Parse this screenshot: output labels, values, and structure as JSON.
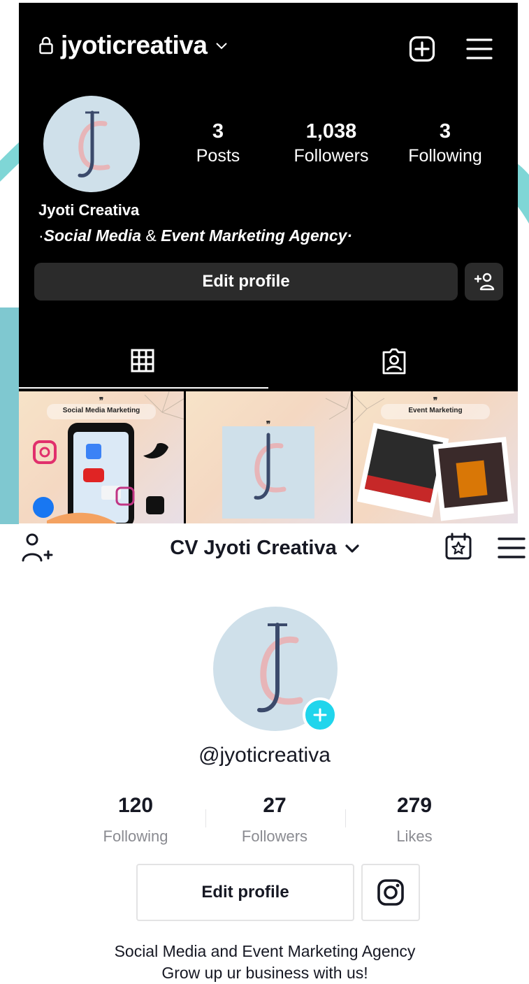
{
  "instagram": {
    "username": "jyoticreativa",
    "stats": [
      {
        "value": "3",
        "label": "Posts"
      },
      {
        "value": "1,038",
        "label": "Followers"
      },
      {
        "value": "3",
        "label": "Following"
      }
    ],
    "full_name": "Jyoti Creativa",
    "bio": {
      "lead": "·",
      "part1": "Social Media",
      "amp": " & ",
      "part2": "Event Marketing Agency",
      "tail": "·"
    },
    "edit_profile_label": "Edit profile",
    "posts": [
      {
        "quote": "❞",
        "caption": "Social Media Marketing"
      },
      {
        "quote": "❞",
        "caption": ""
      },
      {
        "quote": "❞",
        "caption": "Event Marketing"
      }
    ]
  },
  "tiktok": {
    "display_name": "CV Jyoti Creativa",
    "handle": "@jyoticreativa",
    "stats": [
      {
        "value": "120",
        "label": "Following"
      },
      {
        "value": "27",
        "label": "Followers"
      },
      {
        "value": "279",
        "label": "Likes"
      }
    ],
    "edit_profile_label": "Edit profile",
    "bio_lines": [
      "Social Media and Event Marketing Agency",
      "Grow up ur business with us!"
    ]
  },
  "colors": {
    "ig_background": "#000000",
    "ig_button": "#2b2b2b",
    "tt_accent": "#20d5ec",
    "tt_text": "#161823",
    "tt_muted": "#8a8b91",
    "logo_circle": "#cfe0ea"
  },
  "icons": {
    "ig_lock": "lock-icon",
    "ig_create": "plus-square-icon",
    "ig_menu": "hamburger-icon",
    "ig_add_user": "add-person-icon",
    "ig_grid": "grid-icon",
    "ig_tagged": "tagged-person-icon",
    "tt_add_user": "add-person-icon",
    "tt_calendar": "calendar-star-icon",
    "tt_menu": "hamburger-icon",
    "tt_instagram": "instagram-icon"
  }
}
